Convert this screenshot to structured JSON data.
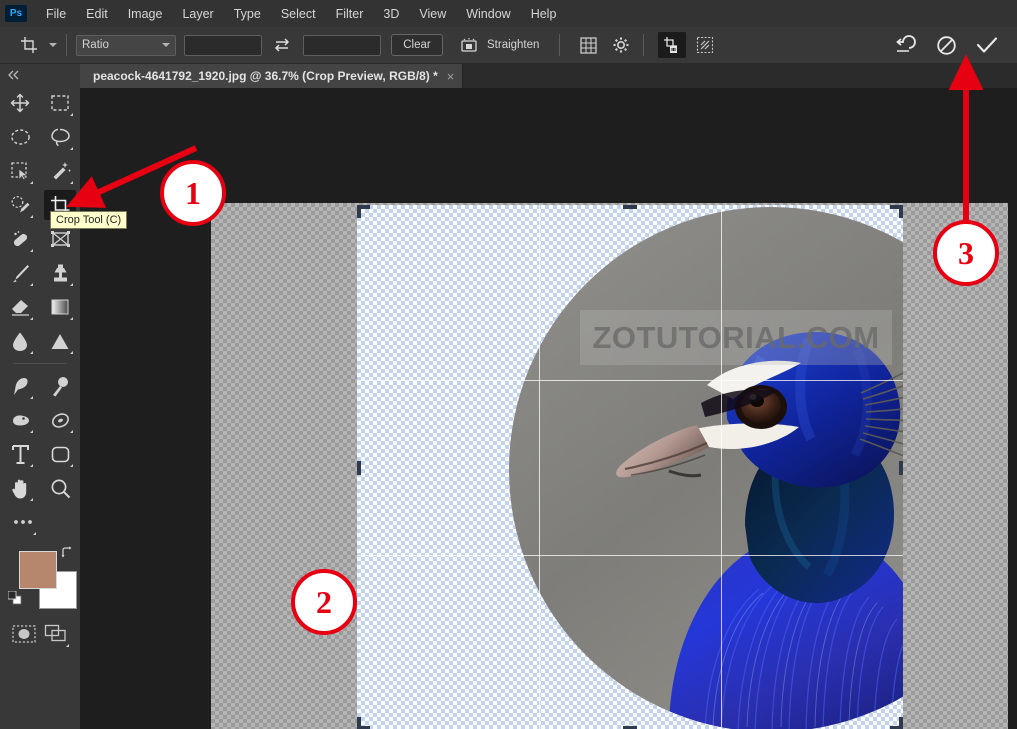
{
  "app": {
    "name": "Adobe Photoshop",
    "logo_text": "Ps",
    "accent_color": "#31a8ff",
    "annotation_color": "#e60012",
    "chrome_color": "#383838",
    "canvas_backdrop": "#1e1e1e"
  },
  "menubar": {
    "items": [
      {
        "label": "File"
      },
      {
        "label": "Edit"
      },
      {
        "label": "Image"
      },
      {
        "label": "Layer"
      },
      {
        "label": "Type"
      },
      {
        "label": "Select"
      },
      {
        "label": "Filter"
      },
      {
        "label": "3D"
      },
      {
        "label": "View"
      },
      {
        "label": "Window"
      },
      {
        "label": "Help"
      }
    ]
  },
  "options_bar": {
    "tool_preset_icon": "crop-tool-icon",
    "ratio_select": {
      "value": "Ratio",
      "chevron": "chevron-down-icon"
    },
    "width_input": {
      "value": "",
      "placeholder": ""
    },
    "swap_icon": "swap-arrows-icon",
    "height_input": {
      "value": "",
      "placeholder": ""
    },
    "clear_button": "Clear",
    "straighten_icon": "straighten-icon",
    "straighten_label": "Straighten",
    "overlay_icon": "grid-overlay-icon",
    "settings_icon": "gear-icon",
    "delete_cropped_icon": "delete-cropped-pixels-icon",
    "content_aware_icon": "content-aware-fill-icon",
    "reset_icon": "reset-icon",
    "cancel_icon": "cancel-icon",
    "commit_icon": "checkmark-icon"
  },
  "document_tab": {
    "title": "peacock-4641792_1920.jpg @ 36.7% (Crop Preview, RGB/8) *",
    "close_glyph": "×"
  },
  "toolbar": {
    "collapse_icon": "double-chevron-left-icon",
    "tools": [
      {
        "name": "move-tool",
        "icon": "move-icon",
        "selected": false
      },
      {
        "name": "rectangular-marquee-tool",
        "icon": "marquee-rect-icon",
        "selected": false
      },
      {
        "name": "elliptical-marquee-tool",
        "icon": "marquee-ellipse-icon",
        "selected": false
      },
      {
        "name": "lasso-tool",
        "icon": "lasso-icon",
        "selected": false
      },
      {
        "name": "object-selection-tool",
        "icon": "object-selection-icon",
        "selected": false
      },
      {
        "name": "magic-wand-tool",
        "icon": "magic-wand-icon",
        "selected": false
      },
      {
        "name": "quick-selection-brush-tool",
        "icon": "quick-selection-icon",
        "selected": false
      },
      {
        "name": "crop-tool",
        "icon": "crop-icon",
        "selected": true
      },
      {
        "name": "healing-brush-tool",
        "icon": "healing-brush-icon",
        "selected": false
      },
      {
        "name": "frame-tool",
        "icon": "frame-icon",
        "selected": false
      },
      {
        "name": "brush-tool",
        "icon": "brush-icon",
        "selected": false
      },
      {
        "name": "clone-stamp-tool",
        "icon": "clone-stamp-icon",
        "selected": false
      },
      {
        "name": "eraser-tool",
        "icon": "eraser-icon",
        "selected": false
      },
      {
        "name": "gradient-tool",
        "icon": "gradient-icon",
        "selected": false
      },
      {
        "name": "blur-tool",
        "icon": "blur-drop-icon",
        "selected": false
      },
      {
        "name": "dodge-tool",
        "icon": "dodge-cone-icon",
        "selected": false
      },
      {
        "name": "pen-tool",
        "icon": "pen-icon",
        "selected": false
      },
      {
        "name": "path-selection-tool",
        "icon": "path-selection-icon",
        "selected": false
      },
      {
        "name": "shape-blob-tool",
        "icon": "blob-icon",
        "selected": false
      },
      {
        "name": "ellipse-shape-tool",
        "icon": "ellipse-shape-icon",
        "selected": false
      },
      {
        "name": "type-tool",
        "icon": "type-t-icon",
        "selected": false
      },
      {
        "name": "rounded-rectangle-tool",
        "icon": "rounded-rect-icon",
        "selected": false
      },
      {
        "name": "hand-tool",
        "icon": "hand-icon",
        "selected": false
      },
      {
        "name": "zoom-tool",
        "icon": "magnifier-icon",
        "selected": false
      }
    ],
    "more_tools_icon": "ellipsis-icon",
    "foreground_color": "#b6876d",
    "background_color": "#ffffff",
    "swap_colors_icon": "swap-colors-icon",
    "default_colors_icon": "default-colors-icon",
    "quick_mask_icon": "quick-mask-icon",
    "screen_mode_icon": "screen-mode-icon"
  },
  "tooltip": {
    "text": "Crop Tool (C)"
  },
  "canvas": {
    "watermark_text": "ZOTUTORIAL.COM",
    "zoom_level": "36.7%",
    "overlay": "rule-of-thirds",
    "subject": "peacock-photo"
  },
  "annotations": [
    {
      "id": "1",
      "label": "1",
      "points_to": "crop-tool"
    },
    {
      "id": "2",
      "label": "2",
      "points_to": "crop-preview-region"
    },
    {
      "id": "3",
      "label": "3",
      "points_to": "commit-checkmark-button"
    }
  ]
}
